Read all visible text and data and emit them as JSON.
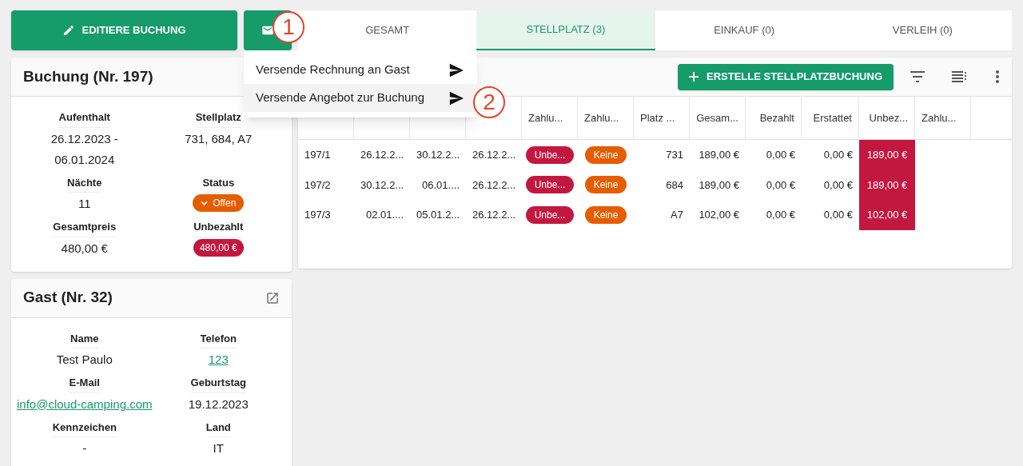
{
  "edit_button": {
    "label": "EDITIERE BUCHUNG"
  },
  "mail_menu": {
    "items": [
      {
        "label": "Versende Rechnung an Gast",
        "selected": false
      },
      {
        "label": "Versende Angebot zur Buchung",
        "selected": true
      }
    ]
  },
  "callouts": [
    {
      "label": "1"
    },
    {
      "label": "2"
    }
  ],
  "tabs": [
    {
      "label": "GESAMT",
      "selected": false
    },
    {
      "label": "STELLPLATZ (3)",
      "selected": true
    },
    {
      "label": "EINKAUF (0)",
      "selected": false
    },
    {
      "label": "VERLEIH (0)",
      "selected": false
    }
  ],
  "booking_card": {
    "title": "Buchung (Nr. 197)",
    "fields": [
      {
        "label": "Aufenthalt",
        "value": "26.12.2023 - 06.01.2024",
        "kind": "text"
      },
      {
        "label": "Stellplatz",
        "value": "731, 684, A7",
        "kind": "text"
      },
      {
        "label": "Nächte",
        "value": "11",
        "kind": "text"
      },
      {
        "label": "Status",
        "value": "Offen",
        "kind": "dropdown",
        "color": "#e65c00"
      },
      {
        "label": "Gesamtpreis",
        "value": "480,00 €",
        "kind": "text"
      },
      {
        "label": "Unbezahlt",
        "value": "480,00 €",
        "kind": "badge",
        "color": "#c2183f"
      }
    ]
  },
  "guest_card": {
    "title": "Gast (Nr. 32)",
    "fields": [
      {
        "label": "Name",
        "value": "Test Paulo",
        "kind": "text"
      },
      {
        "label": "Telefon",
        "value": "123",
        "kind": "link"
      },
      {
        "label": "E-Mail",
        "value": "info@cloud-camping.com",
        "kind": "link"
      },
      {
        "label": "Geburtstag",
        "value": "19.12.2023",
        "kind": "text"
      },
      {
        "label": "Kennzeichen",
        "value": "-",
        "kind": "text"
      },
      {
        "label": "Land",
        "value": "IT",
        "kind": "text"
      }
    ]
  },
  "create_button": {
    "label": "ERSTELLE STELLPLATZBUCHUNG"
  },
  "table": {
    "columns": [
      {
        "kind": "text"
      },
      {
        "kind": "text"
      },
      {
        "kind": "text"
      },
      {
        "kind": "text"
      },
      {
        "label": "Zahlu...",
        "kind": "text"
      },
      {
        "label": "Zahlu...",
        "kind": "text"
      },
      {
        "label": "Platz ...",
        "kind": "text"
      },
      {
        "label": "Gesam...",
        "kind": "amount"
      },
      {
        "label": "Bezahlt",
        "kind": "amount"
      },
      {
        "label": "Erstattet",
        "kind": "amount"
      },
      {
        "label": "Unbez...",
        "kind": "amount"
      },
      {
        "label": "Zahlu...",
        "kind": "text"
      }
    ],
    "rows": [
      [
        {
          "text": "197/1",
          "kind": "text"
        },
        {
          "text": "26.12.2...",
          "kind": "text"
        },
        {
          "text": "30.12.2...",
          "kind": "text"
        },
        {
          "text": "26.12.2...",
          "kind": "text"
        },
        {
          "text": "Unbe...",
          "kind": "badge",
          "color": "#c2183f"
        },
        {
          "text": "Keine",
          "kind": "badge",
          "color": "#e65c00"
        },
        {
          "text": "731",
          "kind": "number"
        },
        {
          "text": "189,00 €",
          "kind": "number"
        },
        {
          "text": "0,00 €",
          "kind": "number"
        },
        {
          "text": "0,00 €",
          "kind": "number"
        },
        {
          "text": "189,00 €",
          "kind": "alert"
        },
        {
          "text": "",
          "kind": "empty"
        }
      ],
      [
        {
          "text": "197/2",
          "kind": "text"
        },
        {
          "text": "30.12.2...",
          "kind": "text"
        },
        {
          "text": "06.01....",
          "kind": "number"
        },
        {
          "text": "26.12.2...",
          "kind": "text"
        },
        {
          "text": "Unbe...",
          "kind": "badge",
          "color": "#c2183f"
        },
        {
          "text": "Keine",
          "kind": "badge",
          "color": "#e65c00"
        },
        {
          "text": "684",
          "kind": "number"
        },
        {
          "text": "189,00 €",
          "kind": "number"
        },
        {
          "text": "0,00 €",
          "kind": "number"
        },
        {
          "text": "0,00 €",
          "kind": "number"
        },
        {
          "text": "189,00 €",
          "kind": "alert"
        },
        {
          "text": "",
          "kind": "empty"
        }
      ],
      [
        {
          "text": "197/3",
          "kind": "text"
        },
        {
          "text": "02.01....",
          "kind": "number"
        },
        {
          "text": "05.01.2...",
          "kind": "text"
        },
        {
          "text": "26.12.2...",
          "kind": "text"
        },
        {
          "text": "Unbe...",
          "kind": "badge",
          "color": "#c2183f"
        },
        {
          "text": "Keine",
          "kind": "badge",
          "color": "#e65c00"
        },
        {
          "text": "A7",
          "kind": "number"
        },
        {
          "text": "102,00 €",
          "kind": "number"
        },
        {
          "text": "0,00 €",
          "kind": "number"
        },
        {
          "text": "0,00 €",
          "kind": "number"
        },
        {
          "text": "102,00 €",
          "kind": "alert"
        },
        {
          "text": "",
          "kind": "empty"
        }
      ]
    ]
  }
}
